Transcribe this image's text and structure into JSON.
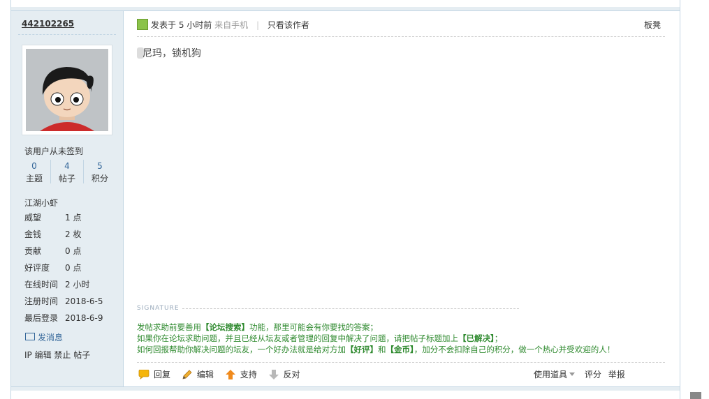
{
  "author": {
    "name": "442102265",
    "sign_status": "该用户从未签到",
    "stats": [
      {
        "value": "0",
        "label": "主题"
      },
      {
        "value": "4",
        "label": "帖子"
      },
      {
        "value": "5",
        "label": "积分"
      }
    ],
    "rank": "江湖小虾",
    "info": [
      {
        "key": "威望",
        "value": "1 点"
      },
      {
        "key": "金钱",
        "value": "2 枚"
      },
      {
        "key": "贡献",
        "value": "0 点"
      },
      {
        "key": "好评度",
        "value": "0 点"
      },
      {
        "key": "在线时间",
        "value": "2 小时"
      },
      {
        "key": "注册时间",
        "value": "2018-6-5"
      },
      {
        "key": "最后登录",
        "value": "2018-6-9"
      }
    ],
    "send_message": "发消息",
    "ip_actions": "IP 编辑 禁止 帖子"
  },
  "post": {
    "posted_label": "发表于",
    "time": "5 小时前",
    "source": "来自手机",
    "only_author": "只看该作者",
    "floor": "板凳",
    "content": "尼玛，锁机狗",
    "signature_label": "SIGNATURE",
    "signature": {
      "line1_a": "发帖求助前要善用",
      "line1_b": "【论坛搜索】",
      "line1_c": "功能，那里可能会有你要找的答案；",
      "line2_a": "如果你在论坛求助问题，并且已经从坛友或者管理的回复中解决了问题，请把帖子标题加上",
      "line2_b": "【已解决】",
      "line2_c": "；",
      "line3_a": "如何回报帮助你解决问题的坛友，一个好办法就是给对方加",
      "line3_b": "【好评】",
      "line3_c": "和",
      "line3_d": "【金币】",
      "line3_e": "，加分不会扣除自己的积分，做一个热心并受欢迎的人！"
    }
  },
  "actions": {
    "reply": "回复",
    "edit": "编辑",
    "support": "支持",
    "oppose": "反对",
    "tools": "使用道具",
    "rate": "评分",
    "report": "举报"
  },
  "colors": {
    "sidebar_bg": "#e5edf2",
    "border": "#c2d5e3",
    "signature_text": "#2f8a2f",
    "link": "#336699"
  }
}
